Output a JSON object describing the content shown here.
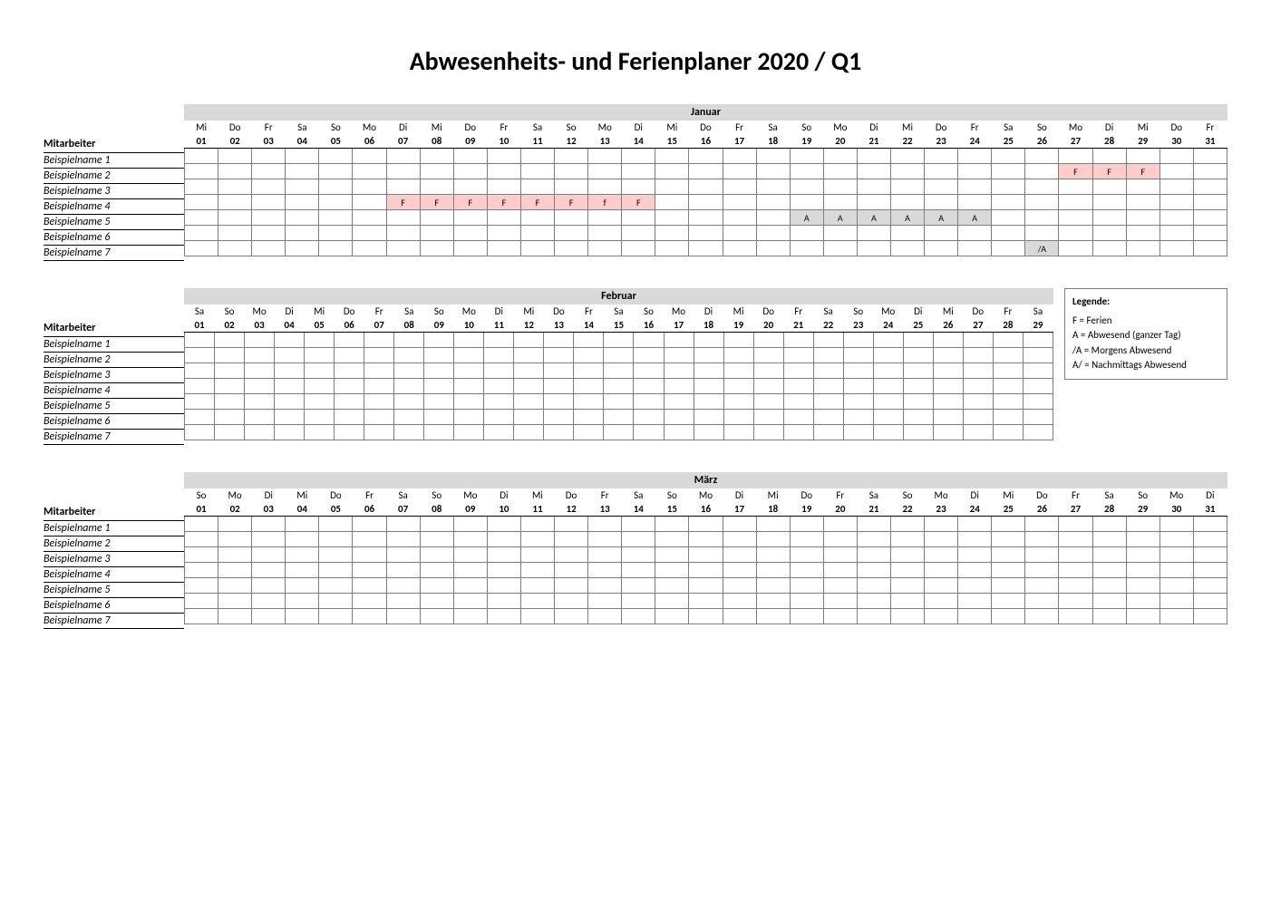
{
  "title": "Abwesenheits- und Ferienplaner 2020 / Q1",
  "employees_label": "Mitarbeiter",
  "employees": [
    "Beispielname 1",
    "Beispielname 2",
    "Beispielname 3",
    "Beispielname 4",
    "Beispielname 5",
    "Beispielname 6",
    "Beispielname 7"
  ],
  "legend": {
    "heading": "Legende:",
    "items": [
      "F = Ferien",
      "A = Abwesend (ganzer Tag)",
      "/A = Morgens Abwesend",
      "A/ = Nachmittags Abwesend"
    ]
  },
  "months": [
    {
      "name": "Januar",
      "days": [
        {
          "dow": "Mi",
          "dom": "01"
        },
        {
          "dow": "Do",
          "dom": "02"
        },
        {
          "dow": "Fr",
          "dom": "03"
        },
        {
          "dow": "Sa",
          "dom": "04"
        },
        {
          "dow": "So",
          "dom": "05"
        },
        {
          "dow": "Mo",
          "dom": "06"
        },
        {
          "dow": "Di",
          "dom": "07"
        },
        {
          "dow": "Mi",
          "dom": "08"
        },
        {
          "dow": "Do",
          "dom": "09"
        },
        {
          "dow": "Fr",
          "dom": "10"
        },
        {
          "dow": "Sa",
          "dom": "11"
        },
        {
          "dow": "So",
          "dom": "12"
        },
        {
          "dow": "Mo",
          "dom": "13"
        },
        {
          "dow": "Di",
          "dom": "14"
        },
        {
          "dow": "Mi",
          "dom": "15"
        },
        {
          "dow": "Do",
          "dom": "16"
        },
        {
          "dow": "Fr",
          "dom": "17"
        },
        {
          "dow": "Sa",
          "dom": "18"
        },
        {
          "dow": "So",
          "dom": "19"
        },
        {
          "dow": "Mo",
          "dom": "20"
        },
        {
          "dow": "Di",
          "dom": "21"
        },
        {
          "dow": "Mi",
          "dom": "22"
        },
        {
          "dow": "Do",
          "dom": "23"
        },
        {
          "dow": "Fr",
          "dom": "24"
        },
        {
          "dow": "Sa",
          "dom": "25"
        },
        {
          "dow": "So",
          "dom": "26"
        },
        {
          "dow": "Mo",
          "dom": "27"
        },
        {
          "dow": "Di",
          "dom": "28"
        },
        {
          "dow": "Mi",
          "dom": "29"
        },
        {
          "dow": "Do",
          "dom": "30"
        },
        {
          "dow": "Fr",
          "dom": "31"
        }
      ],
      "rows": [
        [
          "",
          "",
          "",
          "",
          "",
          "",
          "",
          "",
          "",
          "",
          "",
          "",
          "",
          "",
          "",
          "",
          "",
          "",
          "",
          "",
          "",
          "",
          "",
          "",
          "",
          "",
          "",
          "",
          "",
          "",
          ""
        ],
        [
          "",
          "",
          "",
          "",
          "",
          "",
          "",
          "",
          "",
          "",
          "",
          "",
          "",
          "",
          "",
          "",
          "",
          "",
          "",
          "",
          "",
          "",
          "",
          "",
          "",
          "",
          "F",
          "F",
          "F",
          "",
          ""
        ],
        [
          "",
          "",
          "",
          "",
          "",
          "",
          "",
          "",
          "",
          "",
          "",
          "",
          "",
          "",
          "",
          "",
          "",
          "",
          "",
          "",
          "",
          "",
          "",
          "",
          "",
          "",
          "",
          "",
          "",
          "",
          ""
        ],
        [
          "",
          "",
          "",
          "",
          "",
          "",
          "F",
          "F",
          "F",
          "F",
          "F",
          "F",
          "f",
          "F",
          "",
          "",
          "",
          "",
          "",
          "",
          "",
          "",
          "",
          "",
          "",
          "",
          "",
          "",
          "",
          "",
          ""
        ],
        [
          "",
          "",
          "",
          "",
          "",
          "",
          "",
          "",
          "",
          "",
          "",
          "",
          "",
          "",
          "",
          "",
          "",
          "",
          "A",
          "A",
          "A",
          "A",
          "A",
          "A",
          "",
          "",
          "",
          "",
          "",
          "",
          ""
        ],
        [
          "",
          "",
          "",
          "",
          "",
          "",
          "",
          "",
          "",
          "",
          "",
          "",
          "",
          "",
          "",
          "",
          "",
          "",
          "",
          "",
          "",
          "",
          "",
          "",
          "",
          "",
          "",
          "",
          "",
          "",
          ""
        ],
        [
          "",
          "",
          "",
          "",
          "",
          "",
          "",
          "",
          "",
          "",
          "",
          "",
          "",
          "",
          "",
          "",
          "",
          "",
          "",
          "",
          "",
          "",
          "",
          "",
          "",
          "/A",
          "",
          "",
          "",
          "",
          ""
        ]
      ],
      "show_legend": false
    },
    {
      "name": "Februar",
      "days": [
        {
          "dow": "Sa",
          "dom": "01"
        },
        {
          "dow": "So",
          "dom": "02"
        },
        {
          "dow": "Mo",
          "dom": "03"
        },
        {
          "dow": "Di",
          "dom": "04"
        },
        {
          "dow": "Mi",
          "dom": "05"
        },
        {
          "dow": "Do",
          "dom": "06"
        },
        {
          "dow": "Fr",
          "dom": "07"
        },
        {
          "dow": "Sa",
          "dom": "08"
        },
        {
          "dow": "So",
          "dom": "09"
        },
        {
          "dow": "Mo",
          "dom": "10"
        },
        {
          "dow": "Di",
          "dom": "11"
        },
        {
          "dow": "Mi",
          "dom": "12"
        },
        {
          "dow": "Do",
          "dom": "13"
        },
        {
          "dow": "Fr",
          "dom": "14"
        },
        {
          "dow": "Sa",
          "dom": "15"
        },
        {
          "dow": "So",
          "dom": "16"
        },
        {
          "dow": "Mo",
          "dom": "17"
        },
        {
          "dow": "Di",
          "dom": "18"
        },
        {
          "dow": "Mi",
          "dom": "19"
        },
        {
          "dow": "Do",
          "dom": "20"
        },
        {
          "dow": "Fr",
          "dom": "21"
        },
        {
          "dow": "Sa",
          "dom": "22"
        },
        {
          "dow": "So",
          "dom": "23"
        },
        {
          "dow": "Mo",
          "dom": "24"
        },
        {
          "dow": "Di",
          "dom": "25"
        },
        {
          "dow": "Mi",
          "dom": "26"
        },
        {
          "dow": "Do",
          "dom": "27"
        },
        {
          "dow": "Fr",
          "dom": "28"
        },
        {
          "dow": "Sa",
          "dom": "29"
        }
      ],
      "rows": [
        [
          "",
          "",
          "",
          "",
          "",
          "",
          "",
          "",
          "",
          "",
          "",
          "",
          "",
          "",
          "",
          "",
          "",
          "",
          "",
          "",
          "",
          "",
          "",
          "",
          "",
          "",
          "",
          "",
          ""
        ],
        [
          "",
          "",
          "",
          "",
          "",
          "",
          "",
          "",
          "",
          "",
          "",
          "",
          "",
          "",
          "",
          "",
          "",
          "",
          "",
          "",
          "",
          "",
          "",
          "",
          "",
          "",
          "",
          "",
          ""
        ],
        [
          "",
          "",
          "",
          "",
          "",
          "",
          "",
          "",
          "",
          "",
          "",
          "",
          "",
          "",
          "",
          "",
          "",
          "",
          "",
          "",
          "",
          "",
          "",
          "",
          "",
          "",
          "",
          "",
          ""
        ],
        [
          "",
          "",
          "",
          "",
          "",
          "",
          "",
          "",
          "",
          "",
          "",
          "",
          "",
          "",
          "",
          "",
          "",
          "",
          "",
          "",
          "",
          "",
          "",
          "",
          "",
          "",
          "",
          "",
          ""
        ],
        [
          "",
          "",
          "",
          "",
          "",
          "",
          "",
          "",
          "",
          "",
          "",
          "",
          "",
          "",
          "",
          "",
          "",
          "",
          "",
          "",
          "",
          "",
          "",
          "",
          "",
          "",
          "",
          "",
          ""
        ],
        [
          "",
          "",
          "",
          "",
          "",
          "",
          "",
          "",
          "",
          "",
          "",
          "",
          "",
          "",
          "",
          "",
          "",
          "",
          "",
          "",
          "",
          "",
          "",
          "",
          "",
          "",
          "",
          "",
          ""
        ],
        [
          "",
          "",
          "",
          "",
          "",
          "",
          "",
          "",
          "",
          "",
          "",
          "",
          "",
          "",
          "",
          "",
          "",
          "",
          "",
          "",
          "",
          "",
          "",
          "",
          "",
          "",
          "",
          "",
          ""
        ]
      ],
      "show_legend": true
    },
    {
      "name": "März",
      "days": [
        {
          "dow": "So",
          "dom": "01"
        },
        {
          "dow": "Mo",
          "dom": "02"
        },
        {
          "dow": "Di",
          "dom": "03"
        },
        {
          "dow": "Mi",
          "dom": "04"
        },
        {
          "dow": "Do",
          "dom": "05"
        },
        {
          "dow": "Fr",
          "dom": "06"
        },
        {
          "dow": "Sa",
          "dom": "07"
        },
        {
          "dow": "So",
          "dom": "08"
        },
        {
          "dow": "Mo",
          "dom": "09"
        },
        {
          "dow": "Di",
          "dom": "10"
        },
        {
          "dow": "Mi",
          "dom": "11"
        },
        {
          "dow": "Do",
          "dom": "12"
        },
        {
          "dow": "Fr",
          "dom": "13"
        },
        {
          "dow": "Sa",
          "dom": "14"
        },
        {
          "dow": "So",
          "dom": "15"
        },
        {
          "dow": "Mo",
          "dom": "16"
        },
        {
          "dow": "Di",
          "dom": "17"
        },
        {
          "dow": "Mi",
          "dom": "18"
        },
        {
          "dow": "Do",
          "dom": "19"
        },
        {
          "dow": "Fr",
          "dom": "20"
        },
        {
          "dow": "Sa",
          "dom": "21"
        },
        {
          "dow": "So",
          "dom": "22"
        },
        {
          "dow": "Mo",
          "dom": "23"
        },
        {
          "dow": "Di",
          "dom": "24"
        },
        {
          "dow": "Mi",
          "dom": "25"
        },
        {
          "dow": "Do",
          "dom": "26"
        },
        {
          "dow": "Fr",
          "dom": "27"
        },
        {
          "dow": "Sa",
          "dom": "28"
        },
        {
          "dow": "So",
          "dom": "29"
        },
        {
          "dow": "Mo",
          "dom": "30"
        },
        {
          "dow": "Di",
          "dom": "31"
        }
      ],
      "rows": [
        [
          "",
          "",
          "",
          "",
          "",
          "",
          "",
          "",
          "",
          "",
          "",
          "",
          "",
          "",
          "",
          "",
          "",
          "",
          "",
          "",
          "",
          "",
          "",
          "",
          "",
          "",
          "",
          "",
          "",
          "",
          ""
        ],
        [
          "",
          "",
          "",
          "",
          "",
          "",
          "",
          "",
          "",
          "",
          "",
          "",
          "",
          "",
          "",
          "",
          "",
          "",
          "",
          "",
          "",
          "",
          "",
          "",
          "",
          "",
          "",
          "",
          "",
          "",
          ""
        ],
        [
          "",
          "",
          "",
          "",
          "",
          "",
          "",
          "",
          "",
          "",
          "",
          "",
          "",
          "",
          "",
          "",
          "",
          "",
          "",
          "",
          "",
          "",
          "",
          "",
          "",
          "",
          "",
          "",
          "",
          "",
          ""
        ],
        [
          "",
          "",
          "",
          "",
          "",
          "",
          "",
          "",
          "",
          "",
          "",
          "",
          "",
          "",
          "",
          "",
          "",
          "",
          "",
          "",
          "",
          "",
          "",
          "",
          "",
          "",
          "",
          "",
          "",
          "",
          ""
        ],
        [
          "",
          "",
          "",
          "",
          "",
          "",
          "",
          "",
          "",
          "",
          "",
          "",
          "",
          "",
          "",
          "",
          "",
          "",
          "",
          "",
          "",
          "",
          "",
          "",
          "",
          "",
          "",
          "",
          "",
          "",
          ""
        ],
        [
          "",
          "",
          "",
          "",
          "",
          "",
          "",
          "",
          "",
          "",
          "",
          "",
          "",
          "",
          "",
          "",
          "",
          "",
          "",
          "",
          "",
          "",
          "",
          "",
          "",
          "",
          "",
          "",
          "",
          "",
          ""
        ],
        [
          "",
          "",
          "",
          "",
          "",
          "",
          "",
          "",
          "",
          "",
          "",
          "",
          "",
          "",
          "",
          "",
          "",
          "",
          "",
          "",
          "",
          "",
          "",
          "",
          "",
          "",
          "",
          "",
          "",
          "",
          ""
        ]
      ],
      "show_legend": false
    }
  ]
}
